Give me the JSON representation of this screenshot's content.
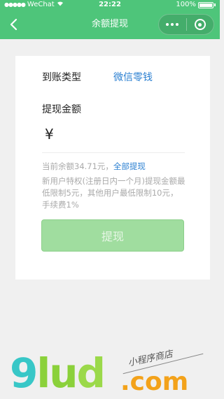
{
  "status_bar": {
    "signal": "●●●●●",
    "carrier": "WeChat",
    "wifi_icon": "wifi-icon",
    "time": "22:22",
    "battery_text": "100%"
  },
  "nav": {
    "title": "余额提现",
    "back_icon": "chevron-left-icon",
    "more_icon": "more-dots-icon",
    "close_icon": "close-circle-icon"
  },
  "form": {
    "receive_type_label": "到账类型",
    "receive_type_value": "微信零钱",
    "amount_label": "提现金额",
    "currency_symbol": "¥",
    "amount_value": "",
    "balance_prefix": "当前余额34.71元，",
    "withdraw_all_link": "全部提现",
    "notice": "新用户特权(注册日内一个月)提现金额最低限制5元，其他用户最低限制10元，手续费1%",
    "submit_label": "提现"
  },
  "watermark": {
    "logo_part1": "9",
    "logo_part2": "lu",
    "logo_part3": "d",
    "dot_com": ".com",
    "tagline": "小程序商店"
  },
  "colors": {
    "brand_green": "#4ec57a",
    "link_blue": "#2a7fd1",
    "button_disabled": "#a0dd9f"
  }
}
